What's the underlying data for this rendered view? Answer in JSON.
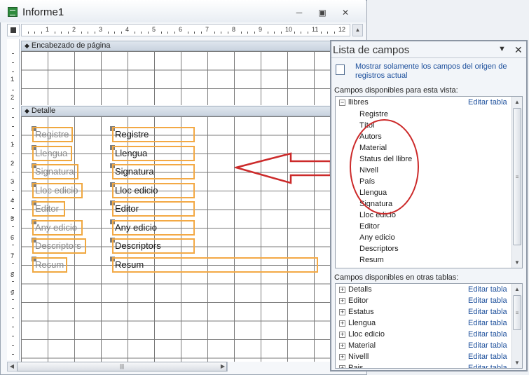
{
  "window": {
    "title": "Informe1",
    "min_label": "─",
    "restore_label": "▣",
    "close_label": "✕"
  },
  "ruler": {
    "top_numbers": [
      "1",
      "2",
      "3",
      "4",
      "5",
      "6",
      "7",
      "8",
      "9",
      "10",
      "11",
      "12"
    ],
    "left_numbers_header": [
      "1",
      "2"
    ],
    "left_numbers_detail": [
      "1",
      "2",
      "3",
      "4",
      "5",
      "6",
      "7",
      "8",
      "9"
    ]
  },
  "sections": {
    "page_header": "Encabezado de página",
    "detail": "Detalle"
  },
  "fields": [
    {
      "label": "Registre",
      "textbox": "Registre"
    },
    {
      "label": "Llengua",
      "textbox": "Llengua"
    },
    {
      "label": "Signatura",
      "textbox": "Signatura"
    },
    {
      "label": "Lloc edicio",
      "textbox": "Lloc edicio"
    },
    {
      "label": "Editor",
      "textbox": "Editor"
    },
    {
      "label": "Any edicio",
      "textbox": "Any edicio"
    },
    {
      "label": "Descriptors",
      "textbox": "Descriptors"
    },
    {
      "label": "Resum",
      "textbox": "Resum"
    }
  ],
  "field_list": {
    "title": "Lista de campos",
    "dropdown_icon": "▼",
    "close_icon": "✕",
    "show_only_link": "Mostrar solamente los campos del origen de registros actual",
    "available_label": "Campos disponibles para esta vista:",
    "table_name": "llibres",
    "edit_table": "Editar tabla",
    "collapse_sign": "−",
    "expand_sign": "+",
    "fields": [
      "Registre",
      "Títol",
      "Autors",
      "Material",
      "Status del llibre",
      "Nivell",
      "País",
      "Llengua",
      "Signatura",
      "Lloc edicio",
      "Editor",
      "Any edicio",
      "Descriptors",
      "Resum"
    ],
    "other_label": "Campos disponibles en otras tablas:",
    "other_tables": [
      "Detalls",
      "Editor",
      "Estatus",
      "Llengua",
      "Lloc edicio",
      "Material",
      "Nivelll",
      "Pais"
    ]
  },
  "colors": {
    "control_border": "#f0a840",
    "annotation_red": "#cc2a2a",
    "link_blue": "#1b4e9b"
  }
}
